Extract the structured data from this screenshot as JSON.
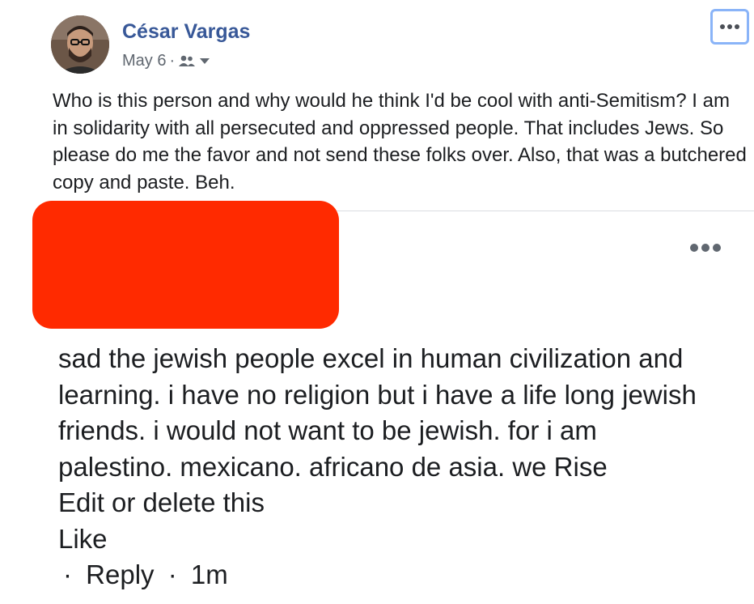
{
  "post": {
    "author_name": "César Vargas",
    "date": "May 6",
    "separator": "·",
    "audience_icon": "friends-icon",
    "audience_caret_icon": "caret-down-icon",
    "menu_icon": "more-options-icon",
    "text": "Who is this person and why would he think I'd be cool with anti-Semitism? I am in solidarity with all persecuted and oppressed people. That includes Jews. So please do me the favor and not send these folks over. Also, that was a butchered copy and paste. Beh.",
    "colors": {
      "author": "#385898",
      "meta": "#606770",
      "text": "#1c1e21",
      "focus_ring": "#8ab4f8"
    }
  },
  "comment": {
    "redaction_color": "#ff2a00",
    "menu_icon": "more-options-icon",
    "text_lines": [
      "sad the jewish people excel in human civilization and",
      "learning. i have no religion but i have a life long jewish",
      "friends. i would not want to be jewish. for i am",
      "palestino. mexicano. africano de asia. we Rise"
    ],
    "edit_delete_label": "Edit or delete this",
    "like_label": "Like",
    "reply_prefix": "·",
    "reply_label": "Reply",
    "time_separator": "·",
    "timestamp": "1m"
  }
}
